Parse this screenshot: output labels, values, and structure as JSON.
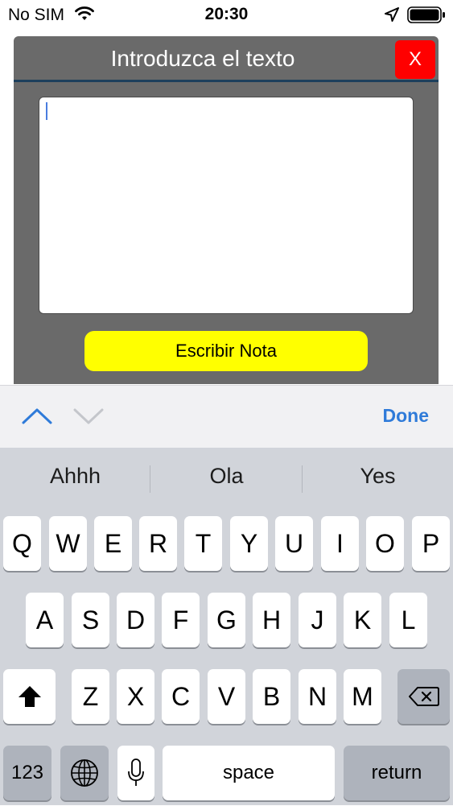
{
  "status_bar": {
    "carrier": "No SIM",
    "time": "20:30"
  },
  "dialog": {
    "title": "Introduzca el texto",
    "close_label": "X",
    "textarea_value": "",
    "write_button_label": "Escribir Nota"
  },
  "toolbar": {
    "done_label": "Done"
  },
  "keyboard": {
    "suggestions": [
      "Ahhh",
      "Ola",
      "Yes"
    ],
    "row1": [
      "Q",
      "W",
      "E",
      "R",
      "T",
      "Y",
      "U",
      "I",
      "O",
      "P"
    ],
    "row2": [
      "A",
      "S",
      "D",
      "F",
      "G",
      "H",
      "J",
      "K",
      "L"
    ],
    "row3": [
      "Z",
      "X",
      "C",
      "V",
      "B",
      "N",
      "M"
    ],
    "numbers_label": "123",
    "space_label": "space",
    "return_label": "return"
  },
  "colors": {
    "dialog_bg": "#6a6a6a",
    "close_button": "#ff0000",
    "write_button": "#ffff00",
    "accent_blue": "#2f7bd9",
    "keyboard_bg": "#d1d4da"
  }
}
